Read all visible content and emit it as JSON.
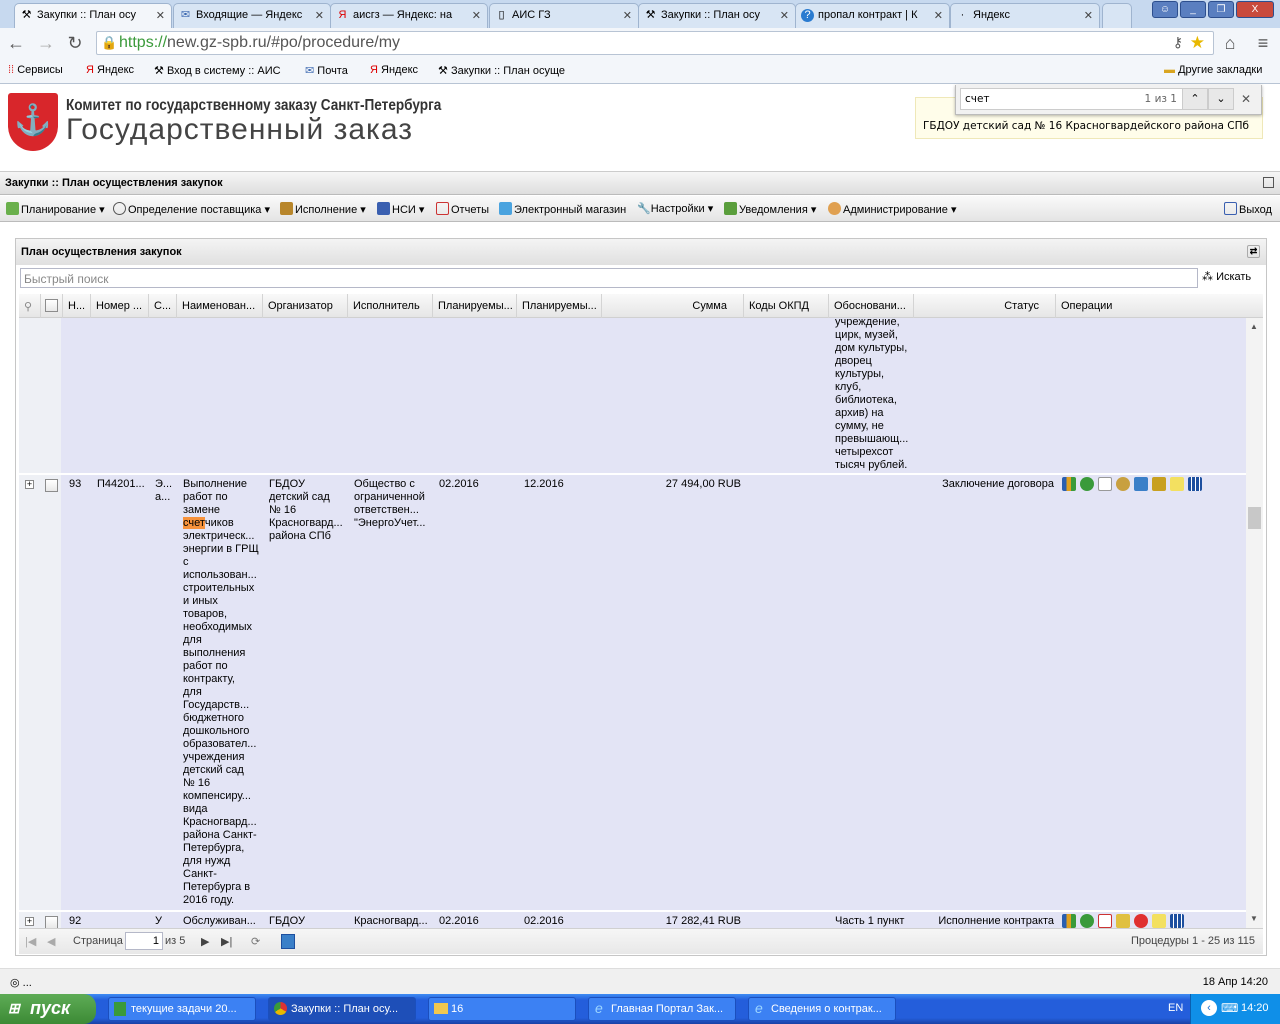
{
  "browser": {
    "tabs": [
      {
        "label": "Закупки :: План осу",
        "icon": "gavel-icon",
        "active": true
      },
      {
        "label": "Входящие — Яндекс",
        "icon": "mail-icon"
      },
      {
        "label": "аисгз — Яндекс: на",
        "icon": "yandex-icon"
      },
      {
        "label": "АИС ГЗ",
        "icon": "page-icon"
      },
      {
        "label": "Закупки :: План осу",
        "icon": "gavel-icon"
      },
      {
        "label": "пропал контракт | К",
        "icon": "question-icon"
      },
      {
        "label": "Яндекс",
        "icon": "yandex-icon"
      }
    ],
    "url_scheme": "https://",
    "url_rest": "new.gz-spb.ru/#po/procedure/my",
    "bookmarks": [
      "Сервисы",
      "Яндекс",
      "Вход в систему :: АИС",
      "Почта",
      "Яндекс",
      "Закупки :: План осуще"
    ],
    "other_bookmarks": "Другие закладки",
    "find": {
      "query": "счет",
      "count": "1 из 1"
    }
  },
  "site": {
    "org_name": "Комитет по государственному заказу Санкт-Петербурга",
    "title": "Государственный заказ",
    "user_org": "ГБДОУ детский сад № 16 Красногвардейского района СПб"
  },
  "page_title": "Закупки :: План осуществления закупок",
  "menu": [
    "Планирование",
    "Определение поставщика",
    "Исполнение",
    "НСИ",
    "Отчеты",
    "Электронный магазин",
    "Настройки",
    "Уведомления",
    "Администрирование"
  ],
  "logout": "Выход",
  "panel": {
    "title": "План осуществления закупок",
    "search_placeholder": "Быстрый поиск",
    "search_button": "Искать",
    "columns": [
      "Н...",
      "Номер ...",
      "С...",
      "Наименован...",
      "Организатор",
      "Исполнитель",
      "Планируемы...",
      "Планируемы...",
      "Сумма",
      "Коды ОКПД",
      "Обосновани...",
      "Статус",
      "Операции"
    ],
    "prev_row_basis": "учреждение,\nцирк, музей,\nдом культуры,\nдворец\nкультуры,\nклуб,\nбиблиотека,\nархив) на\nсумму, не\nпревышающ...\nчетырехсот\nтысяч рублей.",
    "rows": [
      {
        "n": "93",
        "number": "П44201...",
        "s": "Э...\nа...",
        "name_pre": "Выполнение\nработ по\nзамене\n",
        "name_hl": "счет",
        "name_post": "чиков\nэлектрическ...\nэнергии в ГРЩ\nс\nиспользован...\nстроительных\nи иных\nтоваров,\nнеобходимых\nдля\nвыполнения\nработ по\nконтракту,\nдля\nГосударств...\nбюджетного\nдошкольного\nобразовател...\nучреждения\nдетский сад\n№ 16\nкомпенсиру...\nвида\nКрасногвард...\nрайона Санкт-\nПетербурга,\nдля нужд\nСанкт-\nПетербурга в\n2016 году.",
        "organizer": "ГБДОУ\nдетский сад\n№ 16\nКрасногвард...\nрайона СПб",
        "executor": "Общество с\nограниченной\nответствен...\n\"ЭнергоУчет...",
        "plan_start": "02.2016",
        "plan_end": "12.2016",
        "sum": "27 494,00 RUB",
        "okpd": "",
        "basis": "",
        "status": "Заключение договора"
      },
      {
        "n": "92",
        "number": "",
        "s": "У",
        "name": "Обслуживан...",
        "organizer": "ГБДОУ",
        "executor": "Красногвард...",
        "plan_start": "02.2016",
        "plan_end": "02.2016",
        "sum": "17 282,41 RUB",
        "basis": "Часть 1 пункт",
        "status": "Исполнение контракта"
      }
    ],
    "pager": {
      "page_label": "Страница",
      "page": "1",
      "of": "из 5",
      "summary": "Процедуры 1 - 25 из 115"
    }
  },
  "status_left": "◎ ...",
  "status_right": "18 Апр 14:20",
  "taskbar": {
    "start": "пуск",
    "tasks": [
      "текущие задачи 20...",
      "Закупки :: План осу...",
      "16",
      "Главная Портал Зак...",
      "Сведения о контрак..."
    ],
    "lang": "EN",
    "time": "14:20"
  }
}
